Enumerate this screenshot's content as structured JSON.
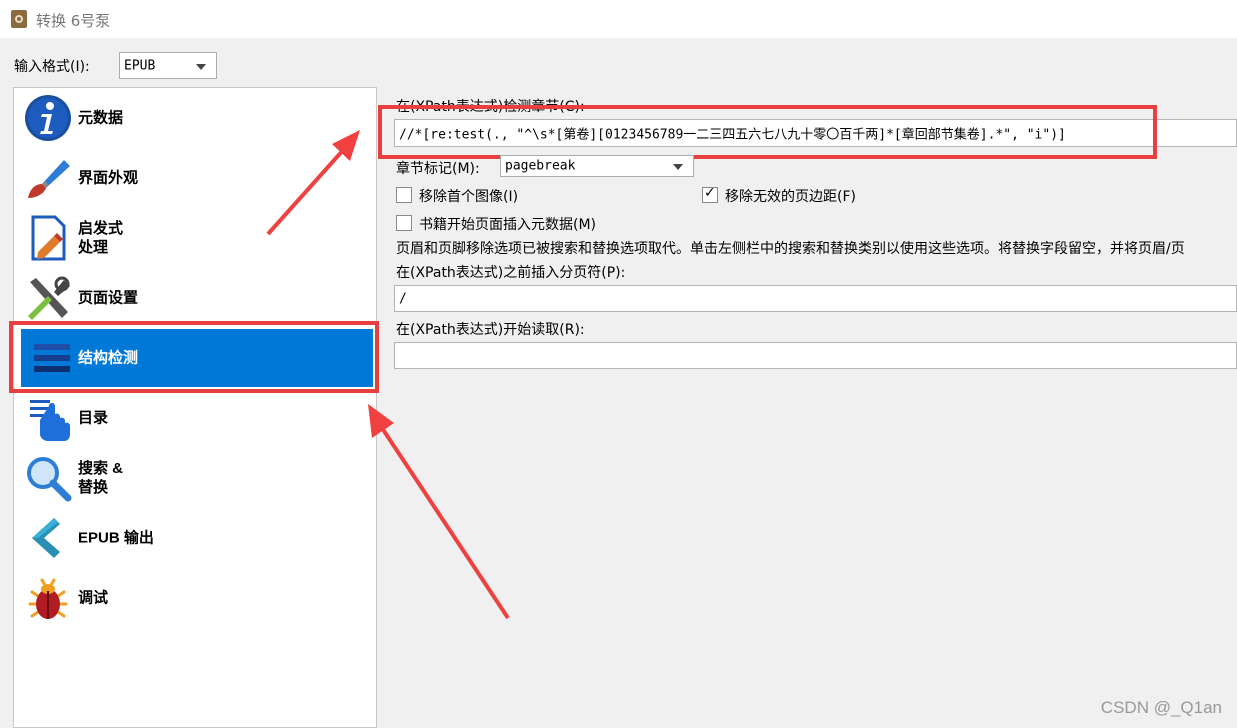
{
  "window": {
    "title": "转换 6号泵"
  },
  "input_format": {
    "label": "输入格式(I):",
    "value": "EPUB"
  },
  "sidebar": {
    "items": [
      {
        "label": "元数据",
        "icon": "info-icon"
      },
      {
        "label": "界面外观",
        "icon": "brush-icon"
      },
      {
        "label": "启发式\n处理",
        "icon": "document-pencil-icon"
      },
      {
        "label": "页面设置",
        "icon": "tools-icon"
      },
      {
        "label": "结构检测",
        "icon": "structure-lines-icon",
        "selected": true
      },
      {
        "label": "目录",
        "icon": "toc-pointer-icon"
      },
      {
        "label": "搜索 &\n替换",
        "icon": "magnifier-icon"
      },
      {
        "label": "EPUB 输出",
        "icon": "epub-chevron-icon"
      },
      {
        "label": "调试",
        "icon": "bug-icon"
      }
    ]
  },
  "structure": {
    "chapter_xpath_label": "在(XPath表达式)检测章节(C):",
    "chapter_xpath_value": "//*[re:test(., \"^\\s*[第卷][0123456789一二三四五六七八九十零〇百千两]*[章回部节集卷].*\", \"i\")]",
    "chapter_mark_label": "章节标记(M):",
    "chapter_mark_value": "pagebreak",
    "remove_first_image": {
      "label": "移除首个图像(I)",
      "checked": false
    },
    "remove_fake_margins": {
      "label": "移除无效的页边距(F)",
      "checked": true
    },
    "insert_metadata": {
      "label": "书籍开始页面插入元数据(M)",
      "checked": false
    },
    "header_footer_note": "页眉和页脚移除选项已被搜索和替换选项取代。单击左侧栏中的搜索和替换类别以使用这些选项。将替换字段留空，并将页眉/页",
    "page_break_label": "在(XPath表达式)之前插入分页符(P):",
    "page_break_value": "/",
    "start_reading_label": "在(XPath表达式)开始读取(R):",
    "start_reading_value": ""
  },
  "watermark": "CSDN @_Q1an",
  "colors": {
    "selected_bg": "#0078d7",
    "highlight": "#e8403e"
  }
}
